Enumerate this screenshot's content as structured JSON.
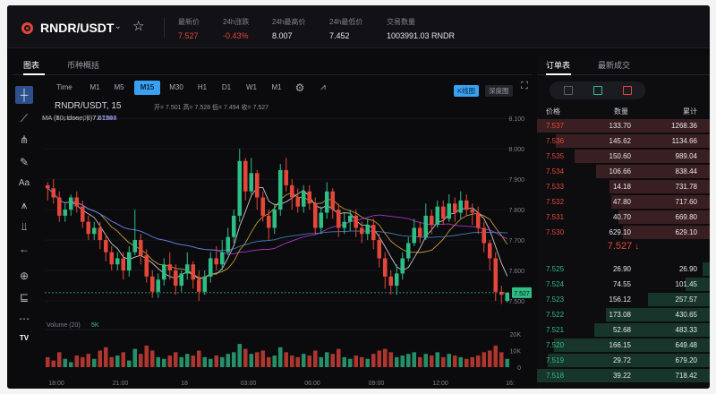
{
  "header": {
    "pair": "RNDR/USDT",
    "last_price_label": "最新价",
    "last_price": "7.527",
    "change_label": "24h涨跌",
    "change": "-0.43%",
    "high_label": "24h最高价",
    "high": "8.007",
    "low_label": "24h最低价",
    "low": "7.452",
    "volume_label": "交易数量",
    "volume": "1003991.03 RNDR"
  },
  "chart_panel": {
    "tabs": [
      "图表",
      "币种概括"
    ],
    "timeframes": [
      "Time",
      "M1",
      "M5",
      "M15",
      "M30",
      "H1",
      "D1",
      "W1",
      "M1"
    ],
    "active_timeframe": "M15",
    "kline_label": "K线图",
    "depth_label": "深度图",
    "symbol": "RNDR/USDT, 15",
    "ohlc_text": "开= 7.501 高= 7.528 低= 7.494 收= 7.527",
    "ma": [
      {
        "label": "MA (5, close, 0)",
        "value": "7.6134",
        "color": "#e8e8e8"
      },
      {
        "label": "MA (10, close, 0)",
        "value": "7.7103",
        "color": "#e2b33a"
      },
      {
        "label": "MA (30, close, 0)",
        "value": "7.7148",
        "color": "#c23ee0"
      },
      {
        "label": "MA (60, close, 0)",
        "value": "7.7524",
        "color": "#4a8fd8"
      }
    ],
    "volume_label": "Volume (20)",
    "volume_value": "5K",
    "current_price_tag": "7.527",
    "tools": [
      "crosshair-icon",
      "trendline-icon",
      "fork-icon",
      "brush-icon",
      "text-icon",
      "pattern-icon",
      "measure-icon",
      "arrow-left-icon",
      "zoom-icon",
      "ruler-icon",
      "more-icon",
      "tradingview-logo"
    ]
  },
  "chart_data": {
    "type": "candlestick",
    "y_ticks": [
      "8.100",
      "8.000",
      "7.900",
      "7.800",
      "7.700",
      "7.600",
      "7.500"
    ],
    "vol_ticks": [
      "20K",
      "10K",
      "0"
    ],
    "x_ticks": [
      "18:00",
      "21:00",
      "18",
      "03:00",
      "06:00",
      "09:00",
      "12:00",
      "16:"
    ],
    "ylim": [
      7.45,
      8.13
    ],
    "candles": [
      [
        7.88,
        7.87,
        7.89,
        7.83
      ],
      [
        7.87,
        7.84,
        7.9,
        7.82
      ],
      [
        7.84,
        7.78,
        7.86,
        7.76
      ],
      [
        7.78,
        7.8,
        7.82,
        7.76
      ],
      [
        7.8,
        7.84,
        7.85,
        7.78
      ],
      [
        7.84,
        7.81,
        7.86,
        7.79
      ],
      [
        7.81,
        7.76,
        7.83,
        7.74
      ],
      [
        7.76,
        7.72,
        7.78,
        7.7
      ],
      [
        7.72,
        7.74,
        7.76,
        7.7
      ],
      [
        7.74,
        7.7,
        7.76,
        7.67
      ],
      [
        7.7,
        7.66,
        7.72,
        7.63
      ],
      [
        7.66,
        7.62,
        7.68,
        7.6
      ],
      [
        7.62,
        7.64,
        7.66,
        7.6
      ],
      [
        7.64,
        7.6,
        7.66,
        7.57
      ],
      [
        7.6,
        7.66,
        7.68,
        7.58
      ],
      [
        7.66,
        7.7,
        7.8,
        7.65
      ],
      [
        7.7,
        7.65,
        7.72,
        7.62
      ],
      [
        7.65,
        7.58,
        7.67,
        7.56
      ],
      [
        7.58,
        7.53,
        7.6,
        7.51
      ],
      [
        7.53,
        7.57,
        7.59,
        7.51
      ],
      [
        7.57,
        7.62,
        7.64,
        7.55
      ],
      [
        7.62,
        7.6,
        7.66,
        7.57
      ],
      [
        7.6,
        7.55,
        7.62,
        7.52
      ],
      [
        7.55,
        7.59,
        7.6,
        7.53
      ],
      [
        7.59,
        7.62,
        7.66,
        7.57
      ],
      [
        7.62,
        7.57,
        7.63,
        7.54
      ],
      [
        7.57,
        7.53,
        7.6,
        7.5
      ],
      [
        7.53,
        7.58,
        7.6,
        7.52
      ],
      [
        7.58,
        7.64,
        7.66,
        7.56
      ],
      [
        7.64,
        7.62,
        7.68,
        7.6
      ],
      [
        7.62,
        7.66,
        7.7,
        7.6
      ],
      [
        7.66,
        7.71,
        7.74,
        7.65
      ],
      [
        7.71,
        7.78,
        7.8,
        7.69
      ],
      [
        7.78,
        7.96,
        8.0,
        7.76
      ],
      [
        7.96,
        7.86,
        7.97,
        7.83
      ],
      [
        7.86,
        7.92,
        7.97,
        7.85
      ],
      [
        7.92,
        7.84,
        7.93,
        7.8
      ],
      [
        7.84,
        7.78,
        7.86,
        7.76
      ],
      [
        7.78,
        7.74,
        7.8,
        7.7
      ],
      [
        7.74,
        7.8,
        7.82,
        7.72
      ],
      [
        7.8,
        7.93,
        7.95,
        7.78
      ],
      [
        7.93,
        7.88,
        7.97,
        7.86
      ],
      [
        7.88,
        7.84,
        7.9,
        7.8
      ],
      [
        7.84,
        7.81,
        7.87,
        7.79
      ],
      [
        7.81,
        7.86,
        7.88,
        7.79
      ],
      [
        7.86,
        7.82,
        7.88,
        7.8
      ],
      [
        7.82,
        7.74,
        7.84,
        7.72
      ],
      [
        7.74,
        7.79,
        7.81,
        7.72
      ],
      [
        7.79,
        7.86,
        7.89,
        7.77
      ],
      [
        7.86,
        7.8,
        7.87,
        7.77
      ],
      [
        7.8,
        7.74,
        7.82,
        7.71
      ],
      [
        7.74,
        7.76,
        7.79,
        7.72
      ],
      [
        7.76,
        7.78,
        7.8,
        7.73
      ],
      [
        7.78,
        7.74,
        7.8,
        7.71
      ],
      [
        7.74,
        7.72,
        7.76,
        7.69
      ],
      [
        7.72,
        7.75,
        7.77,
        7.7
      ],
      [
        7.75,
        7.7,
        7.77,
        7.67
      ],
      [
        7.7,
        7.64,
        7.72,
        7.61
      ],
      [
        7.64,
        7.58,
        7.66,
        7.54
      ],
      [
        7.58,
        7.55,
        7.6,
        7.52
      ],
      [
        7.55,
        7.59,
        7.62,
        7.52
      ],
      [
        7.59,
        7.64,
        7.66,
        7.57
      ],
      [
        7.64,
        7.69,
        7.71,
        7.63
      ],
      [
        7.69,
        7.74,
        7.77,
        7.68
      ],
      [
        7.74,
        7.71,
        7.76,
        7.69
      ],
      [
        7.71,
        7.78,
        7.82,
        7.7
      ],
      [
        7.78,
        7.75,
        7.8,
        7.72
      ],
      [
        7.75,
        7.81,
        7.83,
        7.74
      ],
      [
        7.81,
        7.77,
        7.83,
        7.75
      ],
      [
        7.77,
        7.82,
        7.85,
        7.76
      ],
      [
        7.82,
        7.79,
        7.84,
        7.76
      ],
      [
        7.79,
        7.83,
        7.86,
        7.77
      ],
      [
        7.83,
        7.8,
        7.85,
        7.78
      ],
      [
        7.8,
        7.79,
        7.82,
        7.75
      ],
      [
        7.79,
        7.74,
        7.81,
        7.72
      ],
      [
        7.74,
        7.69,
        7.76,
        7.66
      ],
      [
        7.69,
        7.64,
        7.7,
        7.6
      ],
      [
        7.64,
        7.53,
        7.66,
        7.5
      ],
      [
        7.53,
        7.52,
        7.55,
        7.49
      ],
      [
        7.5,
        7.527,
        7.528,
        7.494
      ]
    ],
    "volumes": [
      6,
      4,
      9,
      5,
      3,
      7,
      6,
      8,
      5,
      10,
      12,
      6,
      7,
      9,
      4,
      11,
      8,
      13,
      10,
      6,
      5,
      7,
      9,
      6,
      8,
      7,
      10,
      6,
      5,
      7,
      6,
      8,
      9,
      14,
      11,
      8,
      9,
      10,
      6,
      7,
      12,
      9,
      7,
      6,
      8,
      7,
      10,
      6,
      9,
      8,
      11,
      6,
      5,
      7,
      6,
      5,
      8,
      10,
      11,
      9,
      6,
      7,
      8,
      9,
      6,
      8,
      7,
      9,
      6,
      8,
      7,
      6,
      5,
      6,
      7,
      9,
      10,
      13,
      9,
      5
    ]
  },
  "order_book": {
    "tabs": [
      "订单表",
      "最新成交"
    ],
    "headers": [
      "价格",
      "数量",
      "累计"
    ],
    "asks": [
      {
        "price": "7.537",
        "qty": "133.70",
        "total": "1268.36",
        "depth": 1.0
      },
      {
        "price": "7.536",
        "qty": "145.62",
        "total": "1134.66",
        "depth": 0.89
      },
      {
        "price": "7.535",
        "qty": "150.60",
        "total": "989.04",
        "depth": 0.78
      },
      {
        "price": "7.534",
        "qty": "106.66",
        "total": "838.44",
        "depth": 0.66
      },
      {
        "price": "7.533",
        "qty": "14.18",
        "total": "731.78",
        "depth": 0.58
      },
      {
        "price": "7.532",
        "qty": "47.80",
        "total": "717.60",
        "depth": 0.57
      },
      {
        "price": "7.531",
        "qty": "40.70",
        "total": "669.80",
        "depth": 0.53
      },
      {
        "price": "7.530",
        "qty": "629.10",
        "total": "629.10",
        "depth": 0.5
      }
    ],
    "mid_price": "7.527",
    "mid_arrow": "↓",
    "bids": [
      {
        "price": "7.525",
        "qty": "26.90",
        "total": "26.90",
        "depth": 0.04
      },
      {
        "price": "7.524",
        "qty": "74.55",
        "total": "101.45",
        "depth": 0.14
      },
      {
        "price": "7.523",
        "qty": "156.12",
        "total": "257.57",
        "depth": 0.36
      },
      {
        "price": "7.522",
        "qty": "173.08",
        "total": "430.65",
        "depth": 0.6
      },
      {
        "price": "7.521",
        "qty": "52.68",
        "total": "483.33",
        "depth": 0.67
      },
      {
        "price": "7.520",
        "qty": "166.15",
        "total": "649.48",
        "depth": 0.9
      },
      {
        "price": "7.519",
        "qty": "29.72",
        "total": "679.20",
        "depth": 0.94
      },
      {
        "price": "7.518",
        "qty": "39.22",
        "total": "718.42",
        "depth": 1.0
      }
    ]
  }
}
